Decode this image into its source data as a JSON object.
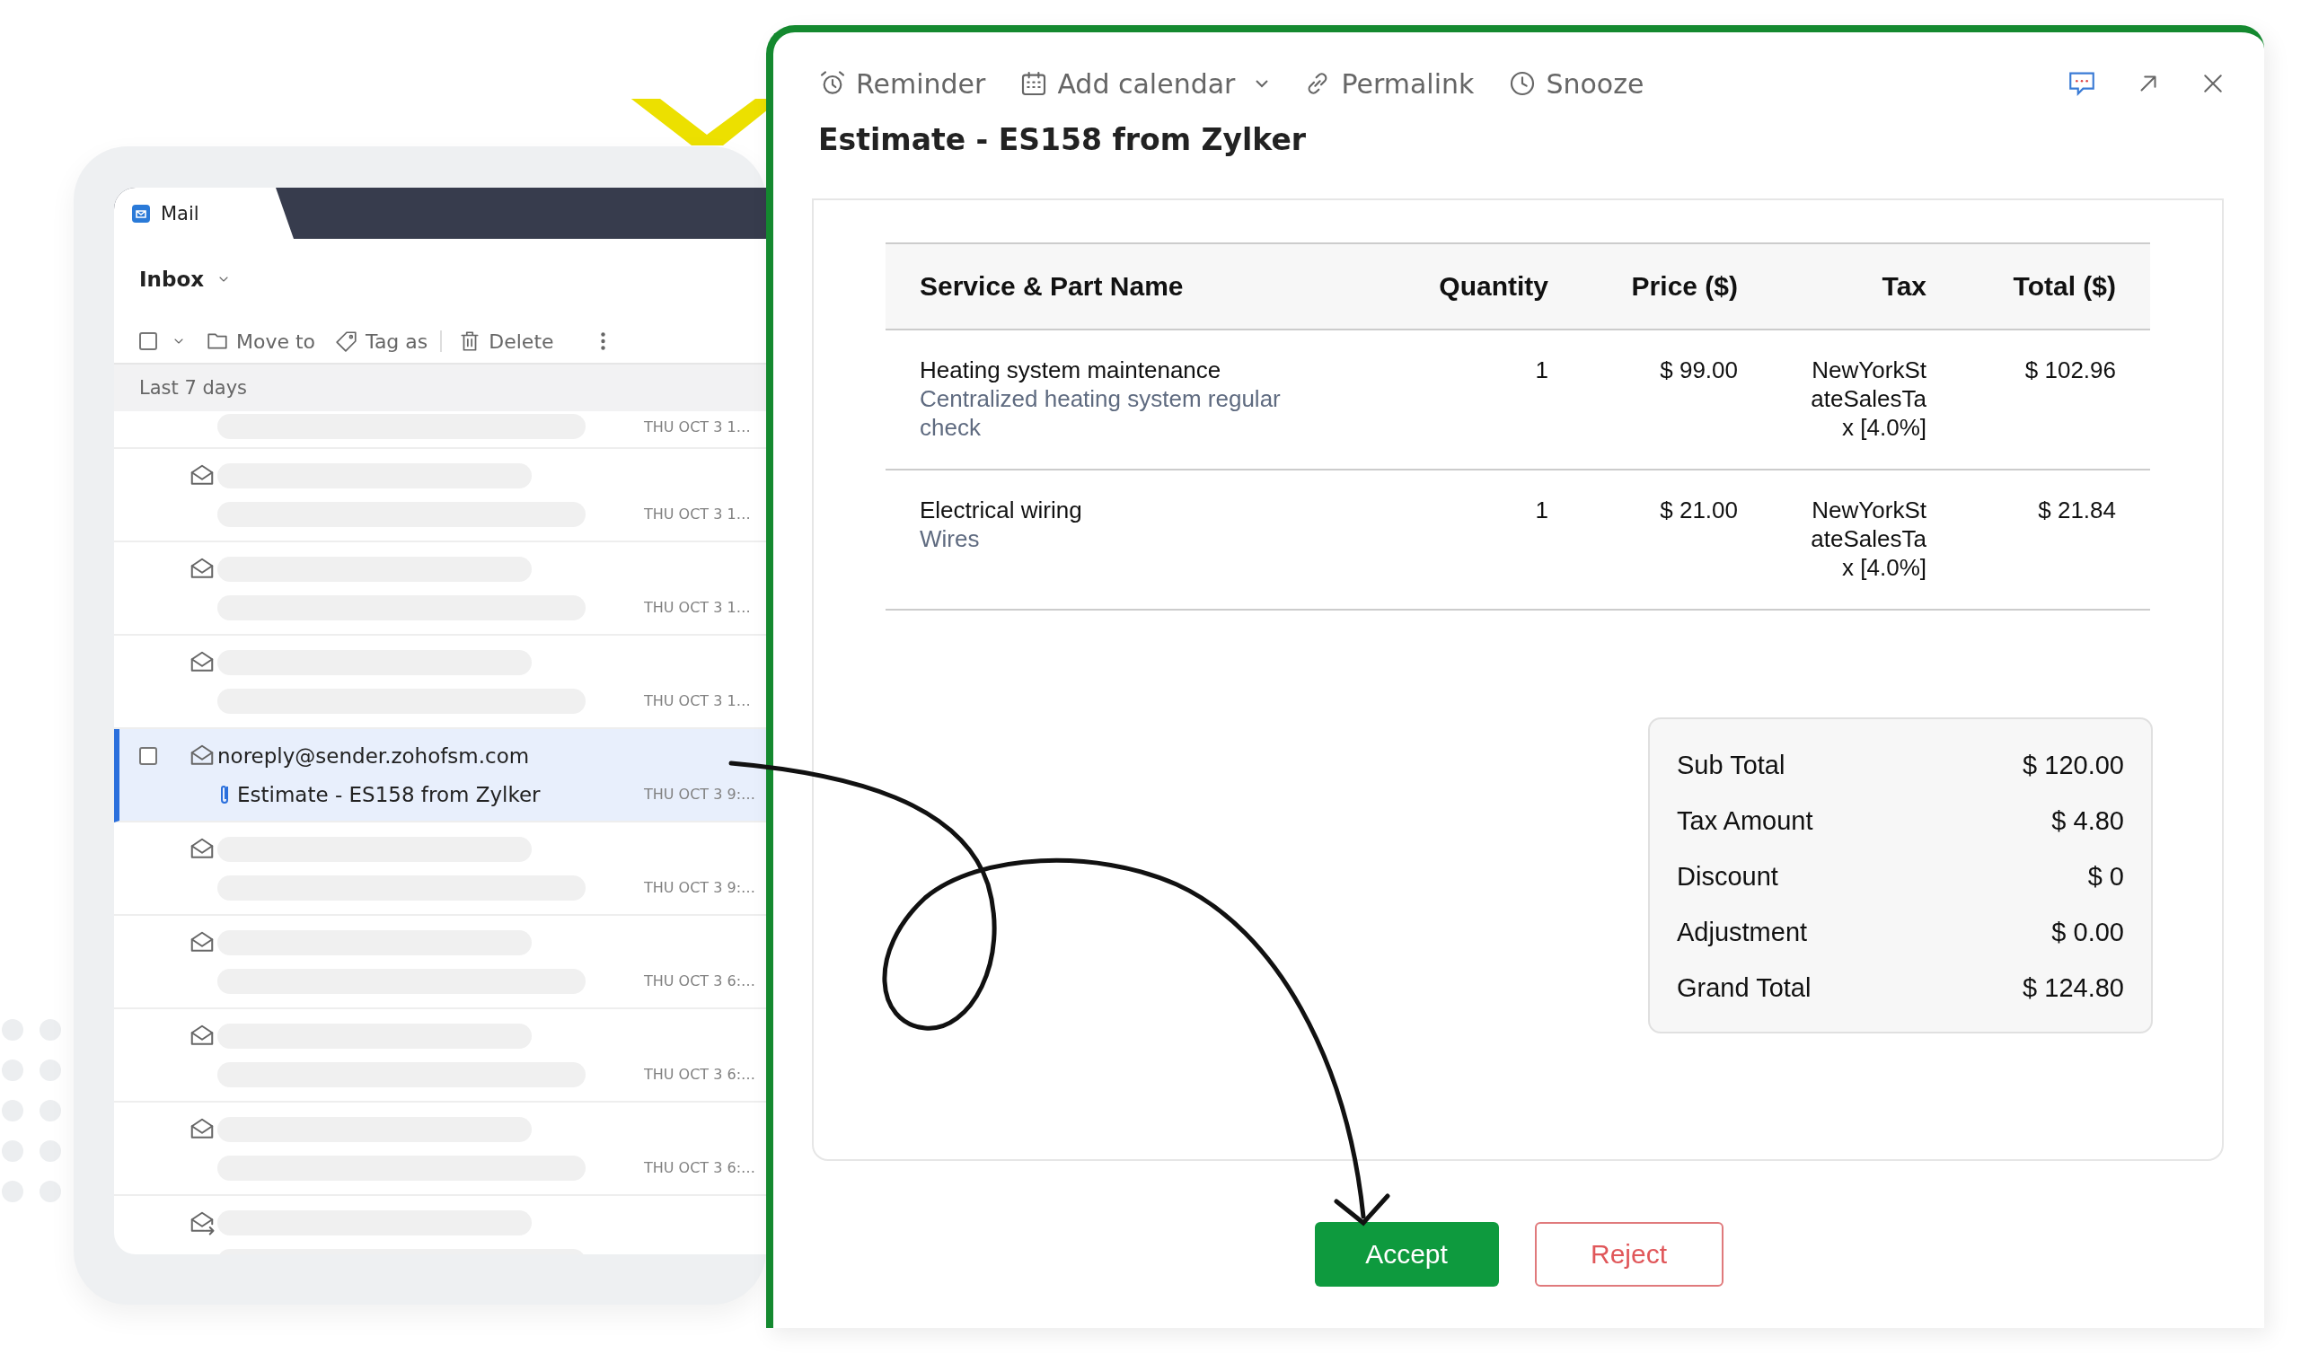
{
  "mail_window": {
    "app_tab": "Mail",
    "folder": "Inbox",
    "select_all_checked": false,
    "toolbar": [
      {
        "kind": "move",
        "label": "Move to"
      },
      {
        "kind": "tag",
        "label": "Tag as"
      },
      {
        "kind": "delete",
        "label": "Delete"
      }
    ],
    "section": "Last 7 days",
    "messages": [
      {
        "kind": "partial",
        "selected": false,
        "date": "THU OCT 3 1…"
      },
      {
        "kind": "placeholder",
        "selected": false,
        "date": "THU OCT 3 1…"
      },
      {
        "kind": "placeholder",
        "selected": false,
        "date": "THU OCT 3 1…"
      },
      {
        "kind": "placeholder",
        "selected": false,
        "date": "THU OCT 3 1…"
      },
      {
        "kind": "message",
        "selected": true,
        "checked": false,
        "sender": "noreply@sender.zohofsm.com",
        "subject": "Estimate - ES158 from Zylker",
        "attachment": true,
        "date": "THU OCT 3 9:…"
      },
      {
        "kind": "placeholder",
        "selected": false,
        "date": "THU OCT 3 9:…"
      },
      {
        "kind": "placeholder",
        "selected": false,
        "date": "THU OCT 3 6:…"
      },
      {
        "kind": "placeholder",
        "selected": false,
        "date": "THU OCT 3 6:…"
      },
      {
        "kind": "placeholder",
        "selected": false,
        "date": "THU OCT 3 6:…"
      },
      {
        "kind": "forwarded",
        "selected": false
      }
    ]
  },
  "message_window": {
    "toolbar": [
      {
        "kind": "reminder",
        "label": "Reminder"
      },
      {
        "kind": "calendar",
        "label": "Add calendar",
        "dropdown": true
      },
      {
        "kind": "permalink",
        "label": "Permalink"
      },
      {
        "kind": "snooze",
        "label": "Snooze"
      }
    ],
    "title": "Estimate - ES158 from Zylker",
    "table": {
      "columns": [
        "Service & Part Name",
        "Quantity",
        "Price ($)",
        "Tax",
        "Total ($)"
      ],
      "rows": [
        {
          "name": "Heating system maintenance",
          "description": "Centralized heating system regular check",
          "quantity": "1",
          "price": "$ 99.00",
          "tax": "NewYorkStateSalesTax [4.0%]",
          "total": "$ 102.96"
        },
        {
          "name": "Electrical wiring",
          "description": "Wires",
          "quantity": "1",
          "price": "$ 21.00",
          "tax": "NewYorkStateSalesTax [4.0%]",
          "total": "$ 21.84"
        }
      ]
    },
    "totals": [
      {
        "label": "Sub Total",
        "value": "$ 120.00"
      },
      {
        "label": "Tax Amount",
        "value": "$ 4.80"
      },
      {
        "label": "Discount",
        "value": "$ 0"
      },
      {
        "label": "Adjustment",
        "value": "$ 0.00"
      },
      {
        "label": "Grand Total",
        "value": "$ 124.80"
      }
    ],
    "buttons": [
      {
        "kind": "primary",
        "label": "Accept"
      },
      {
        "kind": "danger",
        "label": "Reject"
      }
    ]
  }
}
